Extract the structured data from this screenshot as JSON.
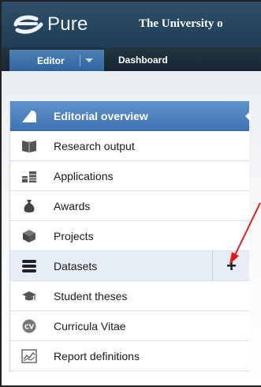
{
  "header": {
    "logo_text": "Pure",
    "organization": "The University o"
  },
  "nav": {
    "editor_label": "Editor",
    "dashboard_label": "Dashboard"
  },
  "menu": {
    "items": [
      {
        "label": "Editorial overview",
        "icon": "editorial-overview-icon",
        "state": "active"
      },
      {
        "label": "Research output",
        "icon": "book-icon"
      },
      {
        "label": "Applications",
        "icon": "applications-icon"
      },
      {
        "label": "Awards",
        "icon": "money-bag-icon"
      },
      {
        "label": "Projects",
        "icon": "cube-icon"
      },
      {
        "label": "Datasets",
        "icon": "database-icon",
        "state": "hover",
        "action": "+"
      },
      {
        "label": "Student theses",
        "icon": "graduation-cap-icon"
      },
      {
        "label": "Curricula Vitae",
        "icon": "cv-icon"
      },
      {
        "label": "Report definitions",
        "icon": "chart-icon"
      }
    ]
  },
  "colors": {
    "header": "#2f4f6a",
    "active": "#4a7fbb",
    "annotation_arrow": "#e0191b"
  }
}
